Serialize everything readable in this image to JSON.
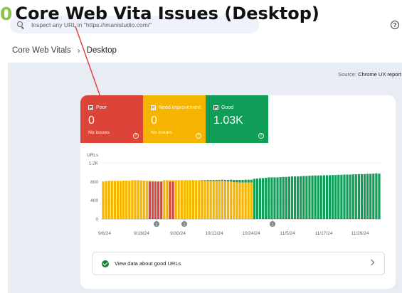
{
  "overlay": {
    "number": "0",
    "title": "Core Web Vita Issues (Desktop)"
  },
  "search": {
    "placeholder": "Inspect any URL in \"https://imanistudio.com/\""
  },
  "help_icon_glyph": "?",
  "breadcrumb": {
    "parent": "Core Web Vitals",
    "separator": "›",
    "current": "Desktop"
  },
  "source": {
    "label": "Source:",
    "value": "Chrome UX report"
  },
  "tiles": [
    {
      "label": "Poor",
      "count": "0",
      "sub": "No issues",
      "color": "#db4437"
    },
    {
      "label": "Need improvement",
      "count": "0",
      "sub": "No issues",
      "color": "#f4b400"
    },
    {
      "label": "Good",
      "count": "1.03K",
      "sub": "",
      "color": "#0f9d58"
    }
  ],
  "tile_help_glyph": "?",
  "good_link": {
    "label": "View data about good URLs"
  },
  "colors": {
    "poor": "#db4437",
    "ni": "#f4b400",
    "good": "#0f9d58",
    "annotation": "#e53935"
  },
  "chart_data": {
    "type": "bar",
    "stacked": true,
    "ylabel": "URLs",
    "yticks": [
      "1.2K",
      "800",
      "400",
      "0"
    ],
    "ytick_values": [
      1200,
      800,
      400,
      0
    ],
    "ylim": [
      0,
      1200
    ],
    "xticks": [
      "9/6/24",
      "9/18/24",
      "9/30/24",
      "10/12/24",
      "10/24/24",
      "11/5/24",
      "11/17/24",
      "11/29/24"
    ],
    "series": [
      {
        "name": "Poor",
        "values": [
          0,
          0,
          0,
          0,
          0,
          0,
          0,
          0,
          0,
          0,
          0,
          0,
          0,
          0,
          0,
          0,
          800,
          800,
          800,
          800,
          800,
          0,
          0,
          800,
          800,
          0,
          0,
          0,
          0,
          0,
          0,
          0,
          0,
          0,
          0,
          0,
          0,
          0,
          0,
          0,
          0,
          0,
          0,
          0,
          0,
          0,
          0,
          0,
          0,
          0,
          0,
          0,
          0,
          0,
          0,
          0,
          0,
          0,
          0,
          0,
          0,
          0,
          0,
          0,
          0,
          0,
          0,
          0,
          0,
          0,
          0,
          0,
          0,
          0,
          0,
          0,
          0,
          0,
          0,
          0,
          0,
          0,
          0,
          0,
          0,
          0,
          0,
          0,
          0,
          0,
          0,
          0,
          0,
          0,
          0,
          0
        ]
      },
      {
        "name": "Need improvement",
        "values": [
          800,
          810,
          815,
          815,
          815,
          815,
          815,
          820,
          820,
          820,
          830,
          830,
          830,
          825,
          820,
          815,
          20,
          15,
          10,
          10,
          10,
          830,
          830,
          30,
          30,
          830,
          830,
          830,
          830,
          830,
          830,
          830,
          830,
          830,
          820,
          815,
          815,
          815,
          815,
          815,
          815,
          815,
          810,
          805,
          800,
          790,
          785,
          780,
          780,
          780,
          780,
          780,
          0,
          0,
          0,
          0,
          0,
          0,
          0,
          0,
          0,
          0,
          0,
          0,
          0,
          0,
          0,
          0,
          0,
          0,
          0,
          0,
          0,
          0,
          0,
          0,
          0,
          0,
          0,
          0,
          0,
          0,
          0,
          0,
          0,
          0,
          0,
          0,
          0,
          0,
          0,
          0,
          0,
          0,
          0,
          0
        ]
      },
      {
        "name": "Good",
        "values": [
          0,
          0,
          0,
          0,
          0,
          0,
          0,
          0,
          0,
          0,
          0,
          0,
          0,
          0,
          0,
          0,
          0,
          0,
          0,
          0,
          0,
          0,
          0,
          0,
          0,
          0,
          0,
          0,
          0,
          0,
          0,
          0,
          0,
          0,
          10,
          15,
          20,
          20,
          20,
          20,
          20,
          25,
          25,
          30,
          40,
          45,
          50,
          55,
          55,
          60,
          60,
          60,
          860,
          865,
          870,
          875,
          880,
          890,
          890,
          890,
          890,
          895,
          900,
          900,
          905,
          910,
          910,
          910,
          915,
          920,
          920,
          925,
          930,
          930,
          930,
          930,
          935,
          935,
          935,
          940,
          940,
          945,
          945,
          950,
          950,
          950,
          955,
          955,
          960,
          960,
          960,
          965,
          965,
          970,
          975,
          970
        ]
      }
    ],
    "annotations": [
      {
        "label": "1",
        "date": "9/21/24"
      },
      {
        "label": "1",
        "date": "9/27/24"
      },
      {
        "label": "1",
        "date": "10/31/24"
      }
    ]
  }
}
